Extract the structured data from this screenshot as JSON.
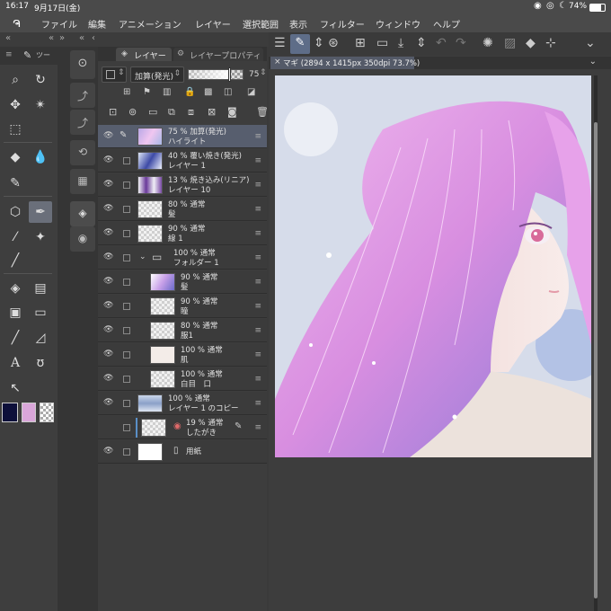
{
  "status": {
    "time": "16:17",
    "date": "9月17日(金)",
    "battery": "74%"
  },
  "menu": {
    "items": [
      "ファイル",
      "編集",
      "アニメーション",
      "レイヤー",
      "選択範囲",
      "表示",
      "フィルター",
      "ウィンドウ",
      "ヘルプ"
    ]
  },
  "panel_tabs": {
    "subtool": "ツー",
    "layer": "レイヤー",
    "layer_props": "レイヤープロパティ"
  },
  "layer_controls": {
    "blend_mode": "加算(発光)",
    "opacity": "75"
  },
  "layers": [
    {
      "pct": "75 %",
      "mode": "加算(発光)",
      "name": "ハイライト",
      "selected": true
    },
    {
      "pct": "40 %",
      "mode": "覆い焼き(発光)",
      "name": "レイヤー 1"
    },
    {
      "pct": "13 %",
      "mode": "焼き込み(リニア)",
      "name": "レイヤー 10"
    },
    {
      "pct": "80 %",
      "mode": "通常",
      "name": "髪"
    },
    {
      "pct": "90 %",
      "mode": "通常",
      "name": "線 1"
    },
    {
      "pct": "100 %",
      "mode": "通常",
      "name": "フォルダー 1"
    },
    {
      "pct": "90 %",
      "mode": "通常",
      "name": "髪"
    },
    {
      "pct": "90 %",
      "mode": "通常",
      "name": "瞳"
    },
    {
      "pct": "80 %",
      "mode": "通常",
      "name": "服1"
    },
    {
      "pct": "100 %",
      "mode": "通常",
      "name": "肌"
    },
    {
      "pct": "100 %",
      "mode": "通常",
      "name": "白目　口"
    },
    {
      "pct": "100 %",
      "mode": "通常",
      "name": "レイヤー 1 のコピー"
    },
    {
      "pct": "19 %",
      "mode": "通常",
      "name": "したがき"
    },
    {
      "pct": "",
      "mode": "",
      "name": "用紙"
    }
  ],
  "canvas": {
    "tab_title": "マギ (2894 x 1415px 350dpi 73.7%)"
  },
  "colors": {
    "main": "#0d0f3a",
    "sub": "#d9a6d9",
    "accent": "#5a8fc7",
    "hair": "#e6a6e6"
  },
  "icons": [
    "hamburger-menu-icon",
    "pen-icon",
    "move-icon",
    "lasso-icon",
    "eraser-icon",
    "fill-icon",
    "text-icon",
    "undo-icon",
    "redo-icon"
  ]
}
